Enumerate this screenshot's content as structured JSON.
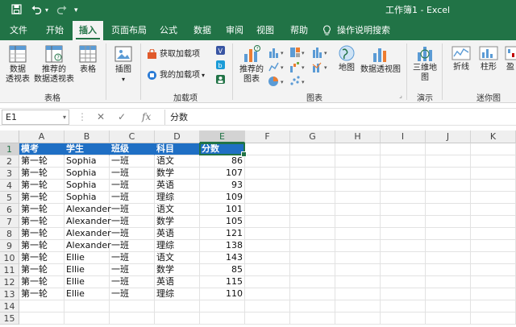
{
  "window": {
    "title": "工作簿1  -  Excel"
  },
  "tabs": [
    {
      "label": "文件",
      "active": false
    },
    {
      "label": "开始",
      "active": false
    },
    {
      "label": "插入",
      "active": true
    },
    {
      "label": "页面布局",
      "active": false
    },
    {
      "label": "公式",
      "active": false
    },
    {
      "label": "数据",
      "active": false
    },
    {
      "label": "审阅",
      "active": false
    },
    {
      "label": "视图",
      "active": false
    },
    {
      "label": "帮助",
      "active": false
    }
  ],
  "tell_me": {
    "label": "操作说明搜索",
    "icon": "lightbulb-icon"
  },
  "ribbon": {
    "groups": {
      "tables": "表格",
      "addins": "加载项",
      "charts": "图表",
      "tours": "演示",
      "sparklines": "迷你图"
    },
    "buttons": {
      "pivot_line1": "数据",
      "pivot_line2": "透视表",
      "rec_pivot_line1": "推荐的",
      "rec_pivot_line2": "数据透视表",
      "table": "表格",
      "illustrations": "插图",
      "get_addins": "获取加载项",
      "my_addins": "我的加载项",
      "rec_charts_line1": "推荐的",
      "rec_charts_line2": "图表",
      "map": "地图",
      "pivot_chart": "数据透视图",
      "map3d_line1": "三维地",
      "map3d_line2": "图",
      "line": "折线",
      "column": "柱形",
      "winloss": "盈"
    }
  },
  "formula_bar": {
    "name_box": "E1",
    "cancel": "✕",
    "enter": "✓",
    "fx": "fx",
    "content": "分数"
  },
  "columns": [
    "A",
    "B",
    "C",
    "D",
    "E",
    "F",
    "G",
    "H",
    "I",
    "J",
    "K"
  ],
  "rows": [
    "1",
    "2",
    "3",
    "4",
    "5",
    "6",
    "7",
    "8",
    "9",
    "10",
    "11",
    "12",
    "13",
    "14",
    "15"
  ],
  "selected_cell": "E1",
  "sheet": {
    "header": [
      "模考",
      "学生",
      "班级",
      "科目",
      "分数"
    ],
    "data": [
      [
        "第一轮",
        "Sophia",
        "一班",
        "语文",
        "86"
      ],
      [
        "第一轮",
        "Sophia",
        "一班",
        "数学",
        "107"
      ],
      [
        "第一轮",
        "Sophia",
        "一班",
        "英语",
        "93"
      ],
      [
        "第一轮",
        "Sophia",
        "一班",
        "理综",
        "109"
      ],
      [
        "第一轮",
        "Alexander",
        "一班",
        "语文",
        "101"
      ],
      [
        "第一轮",
        "Alexander",
        "一班",
        "数学",
        "105"
      ],
      [
        "第一轮",
        "Alexander",
        "一班",
        "英语",
        "121"
      ],
      [
        "第一轮",
        "Alexander",
        "一班",
        "理综",
        "138"
      ],
      [
        "第一轮",
        "Ellie",
        "一班",
        "语文",
        "143"
      ],
      [
        "第一轮",
        "Ellie",
        "一班",
        "数学",
        "85"
      ],
      [
        "第一轮",
        "Ellie",
        "一班",
        "英语",
        "115"
      ],
      [
        "第一轮",
        "Ellie",
        "一班",
        "理综",
        "110"
      ]
    ]
  },
  "colors": {
    "excel_green": "#217346",
    "header_fill": "#1f6fc4"
  }
}
